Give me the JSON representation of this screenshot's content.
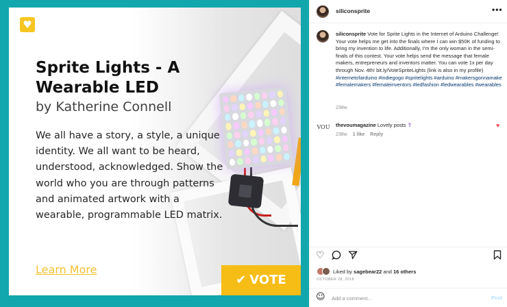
{
  "image": {
    "badge_icon": "heart-icon",
    "title": "Sprite Lights - A Wearable LED",
    "byline": "by Katherine Connell",
    "story": "We all have a story, a style, a unique identity. We all want to be heard, understood, acknowledged. Show the world who you are through patterns and animated artwork with a wearable, programmable LED matrix.",
    "learn_more": "Learn More",
    "vote_label": "VOTE",
    "vote_icon": "check-icon",
    "background_color": "#12a7ad",
    "accent_color": "#f6bd16"
  },
  "header": {
    "username": "siliconsprite",
    "more_icon": "more-horizontal-icon"
  },
  "caption": {
    "username": "siliconsprite",
    "text": "Vote for Sprite Lights in the Internet of Arduino Challenge! Your vote helps me get into the finals where I can win $50K of funding to bring my invention to life. Additionally, I'm the only woman in the semi-finals of this contest. Your vote helps send the message that female makers, entrepreneurs and inventors matter. You can vote 1x per day through Nov. 4th! bit.ly/VoteSpriteLights (link is also in my profile)",
    "hashtags": "#internetofarduino #indiegogo #spritelights #arduino #makersgonnamake #femalemakers #femaleinventors #ledfashion #ledwearables #wearables",
    "age": "238w"
  },
  "comment": {
    "avatar_text": "VOU",
    "username": "thevoumagazine",
    "text": "Lovely posts",
    "emoji": "⇮",
    "age": "238w",
    "likes": "1 like",
    "reply": "Reply"
  },
  "actions": {
    "like_icon": "heart-outline-icon",
    "comment_icon": "comment-icon",
    "share_icon": "share-icon",
    "save_icon": "bookmark-icon"
  },
  "likes": {
    "prefix": "Liked by",
    "user": "sagebear22",
    "middle": "and",
    "others": "16 others"
  },
  "date": "OCTOBER 28, 2018",
  "add_comment": {
    "placeholder": "Add a comment...",
    "post": "Post"
  }
}
